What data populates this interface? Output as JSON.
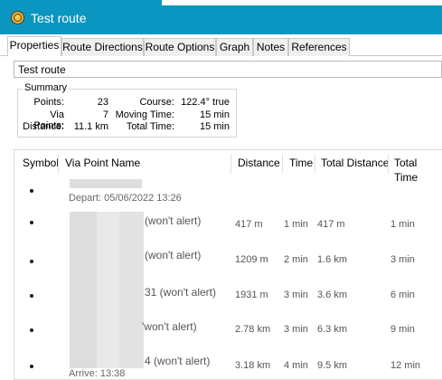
{
  "window": {
    "title": "Test route"
  },
  "tabs": [
    "Properties",
    "Route Directions",
    "Route Options",
    "Graph",
    "Notes",
    "References"
  ],
  "route_name": "Test route",
  "summary": {
    "label": "Summary",
    "points_label": "Points:",
    "points": "23",
    "via_label": "Via Points:",
    "via": "7",
    "distance_label": "Distance:",
    "distance": "11.1 km",
    "course_label": "Course:",
    "course": "122.4° true",
    "moving_label": "Moving Time:",
    "moving": "15 min",
    "total_label": "Total Time:",
    "total": "15 min"
  },
  "columns": [
    "Symbol",
    "Via Point Name",
    "Distance",
    "Time",
    "Total Distance",
    "Total Time"
  ],
  "rows": [
    {
      "name": "",
      "sub": "Depart: 05/06/2022 13:26",
      "distance": "",
      "time": "",
      "total_distance": "",
      "total_time": ""
    },
    {
      "name": "(won't alert)",
      "sub": "",
      "distance": "417 m",
      "time": "1 min",
      "total_distance": "417 m",
      "total_time": "1 min"
    },
    {
      "name": "(won't alert)",
      "sub": "",
      "distance": "1209 m",
      "time": "2 min",
      "total_distance": "1.6 km",
      "total_time": "3 min"
    },
    {
      "name": "31 (won't alert)",
      "sub": "",
      "distance": "1931 m",
      "time": "3 min",
      "total_distance": "3.6 km",
      "total_time": "6 min"
    },
    {
      "name": "'won't alert)",
      "sub": "",
      "distance": "2.78 km",
      "time": "3 min",
      "total_distance": "6.3 km",
      "total_time": "9 min"
    },
    {
      "name": "4 (won't alert)",
      "sub": "Arrive: 13:38",
      "distance": "3.18 km",
      "time": "4 min",
      "total_distance": "9.5 km",
      "total_time": "12 min"
    }
  ]
}
